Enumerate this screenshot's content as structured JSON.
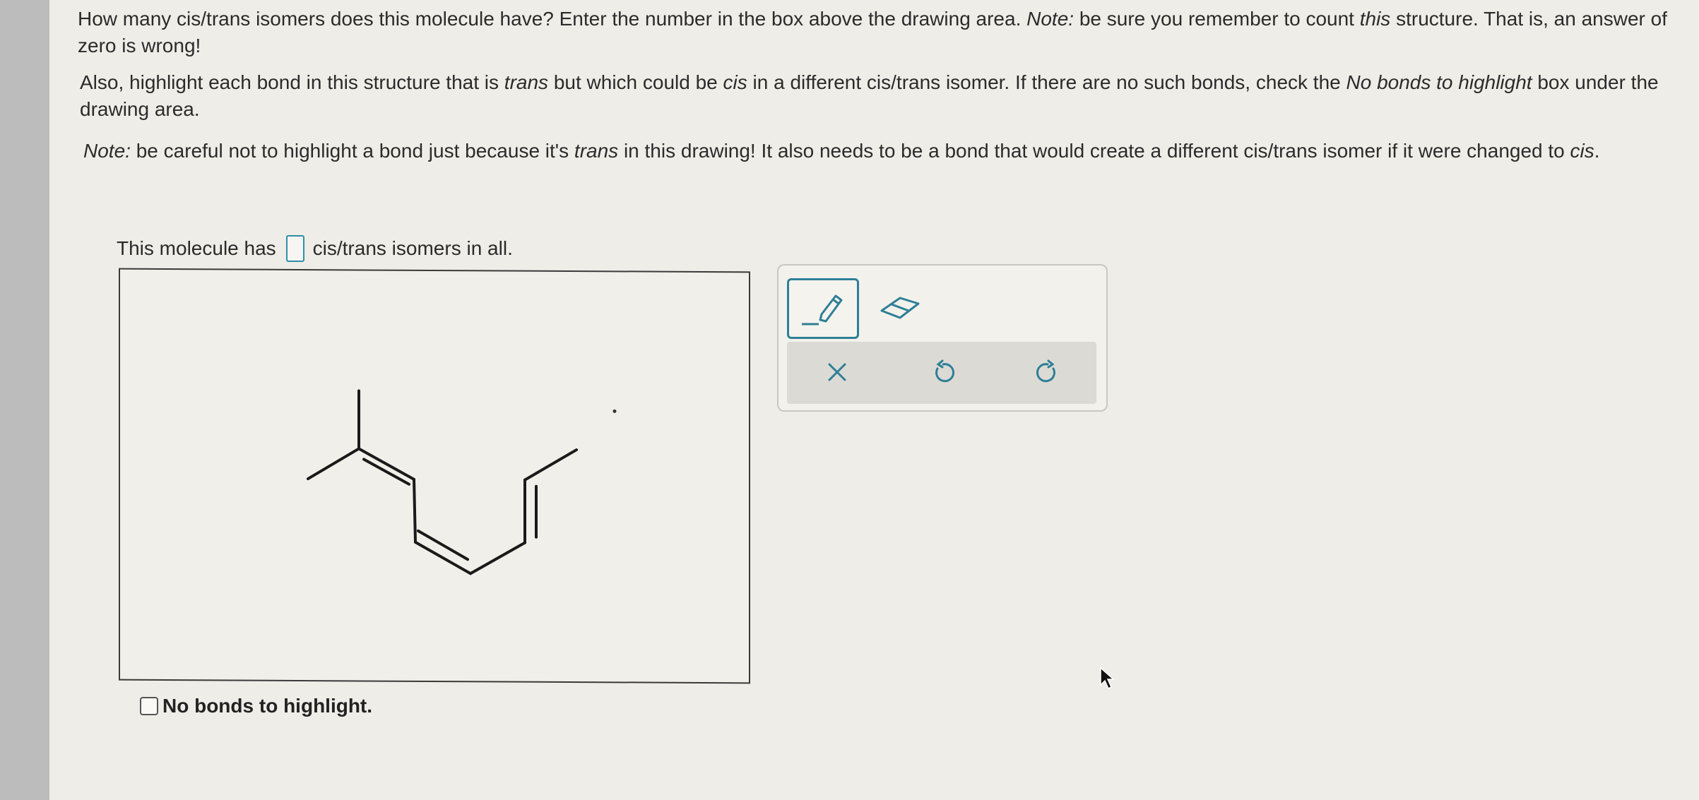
{
  "question": {
    "p1_a": "How many cis/trans isomers does this molecule have? Enter the number in the box above the drawing area. ",
    "p1_note": "Note:",
    "p1_b": " be sure you remember to count ",
    "p1_this": "this",
    "p1_c": " structure. That is, an answer of zero is wrong!",
    "p2_a": "Also, highlight each bond in this structure that is ",
    "p2_trans": "trans",
    "p2_b": " but which could be ",
    "p2_cis": "cis",
    "p2_c": " in a different cis/trans isomer. If there are no such bonds, check the ",
    "p2_nobonds": "No bonds to highlight",
    "p2_d": " box under the drawing area.",
    "p3_note": "Note:",
    "p3_a": " be careful not to highlight a bond just because it's ",
    "p3_trans": "trans",
    "p3_b": " in this drawing! It also needs to be a bond that would create a different cis/trans isomer if it were changed to ",
    "p3_cis": "cis",
    "p3_c": "."
  },
  "answer": {
    "prefix": "This molecule has",
    "suffix": "cis/trans isomers in all.",
    "value": ""
  },
  "checkbox": {
    "label": "No bonds to highlight.",
    "checked": false
  },
  "toolbar": {
    "pencil_icon": "pencil-highlight-icon",
    "eraser_icon": "eraser-icon",
    "clear_icon": "close-icon",
    "undo_icon": "undo-icon",
    "redo_icon": "redo-icon"
  },
  "colors": {
    "accent": "#2e7f96",
    "bond": "#1a1a1a"
  }
}
